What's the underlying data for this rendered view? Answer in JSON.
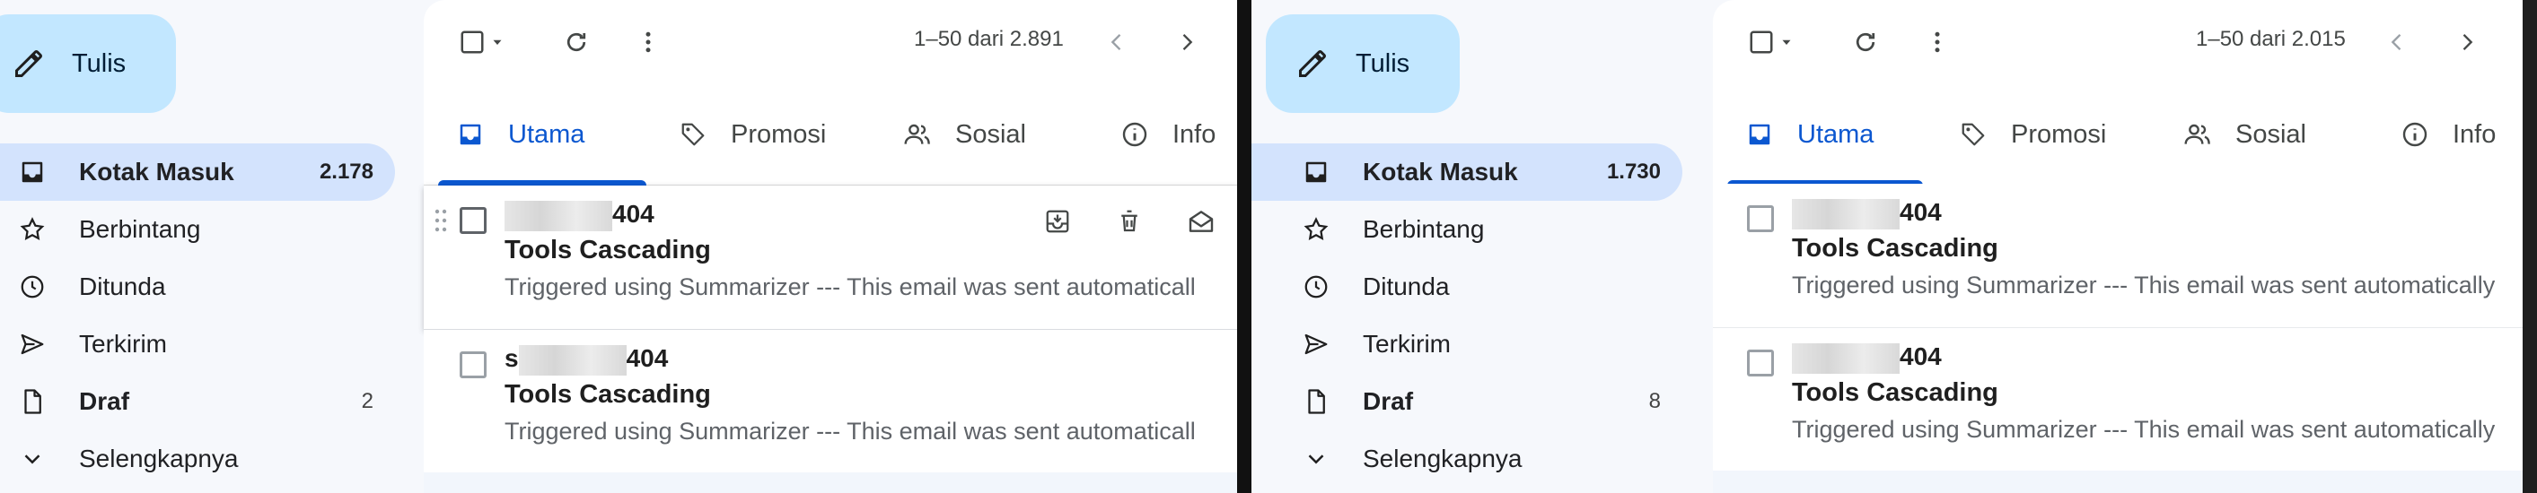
{
  "left": {
    "compose_label": "Tulis",
    "nav": [
      {
        "label": "Kotak Masuk",
        "count": "2.178"
      },
      {
        "label": "Berbintang",
        "count": ""
      },
      {
        "label": "Ditunda",
        "count": ""
      },
      {
        "label": "Terkirim",
        "count": ""
      },
      {
        "label": "Draf",
        "count": "2"
      },
      {
        "label": "Selengkapnya",
        "count": ""
      }
    ],
    "pager": "1–50 dari 2.891",
    "tabs": [
      "Utama",
      "Promosi",
      "Sosial",
      "Info"
    ],
    "emails": [
      {
        "sender_visible": "404",
        "subject": "Tools Cascading",
        "snippet": "Triggered using Summarizer --- This email was sent automaticall"
      },
      {
        "sender_prefix": "s",
        "sender_visible": "404",
        "subject": "Tools Cascading",
        "snippet": "Triggered using Summarizer --- This email was sent automaticall"
      }
    ]
  },
  "right": {
    "compose_label": "Tulis",
    "nav": [
      {
        "label": "Kotak Masuk",
        "count": "1.730"
      },
      {
        "label": "Berbintang",
        "count": ""
      },
      {
        "label": "Ditunda",
        "count": ""
      },
      {
        "label": "Terkirim",
        "count": ""
      },
      {
        "label": "Draf",
        "count": "8"
      },
      {
        "label": "Selengkapnya",
        "count": ""
      }
    ],
    "pager": "1–50 dari 2.015",
    "tabs": [
      "Utama",
      "Promosi",
      "Sosial",
      "Info"
    ],
    "emails": [
      {
        "sender_visible": "404",
        "subject": "Tools Cascading",
        "snippet": "Triggered using Summarizer --- This email was sent automatically"
      },
      {
        "sender_visible": "404",
        "subject": "Tools Cascading",
        "snippet": "Triggered using Summarizer --- This email was sent automatically"
      }
    ]
  },
  "colors": {
    "accent": "#0b57d0",
    "compose_bg": "#c2e7ff",
    "active_nav": "#d3e3fd",
    "sidebar_bg": "#f6f8fc"
  },
  "icons": [
    "pencil-icon",
    "inbox-icon",
    "star-icon",
    "clock-icon",
    "send-icon",
    "file-icon",
    "chevron-down-icon",
    "checkbox-icon",
    "refresh-icon",
    "more-vert-icon",
    "chevron-left-icon",
    "chevron-right-icon",
    "tag-icon",
    "people-icon",
    "info-icon",
    "archive-icon",
    "trash-icon",
    "mark-read-icon"
  ]
}
